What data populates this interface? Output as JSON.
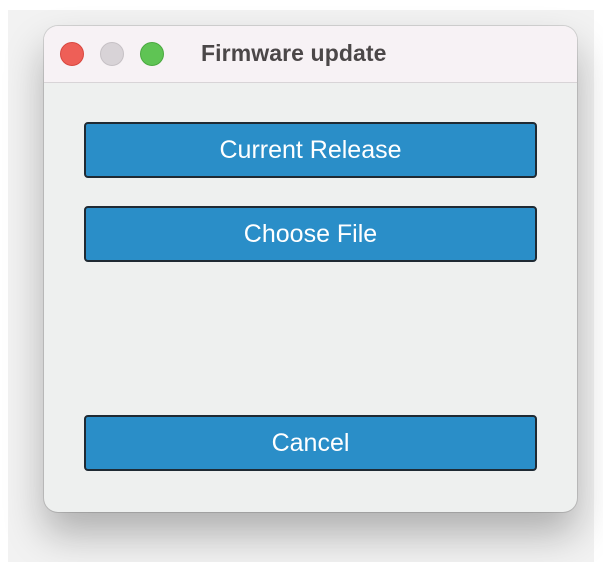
{
  "window": {
    "title": "Firmware update"
  },
  "buttons": {
    "current_release": "Current Release",
    "choose_file": "Choose File",
    "cancel": "Cancel"
  },
  "colors": {
    "button_fill": "#2a8ec8",
    "button_border": "#1f2a33",
    "window_bg": "#eef0ef",
    "close_light": "#ee5f57",
    "minimize_light": "#d8d3d7",
    "maximize_light": "#5fc454"
  }
}
